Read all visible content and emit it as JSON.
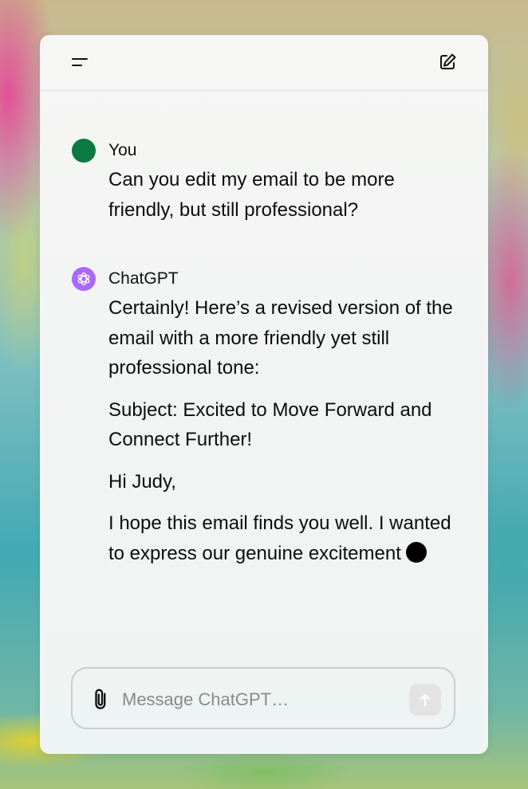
{
  "header": {
    "menu_icon": "menu-icon",
    "compose_icon": "new-chat-icon"
  },
  "messages": [
    {
      "author": "You",
      "avatar_color": "#0b7a40",
      "paragraphs": [
        "Can you edit my email to be more friendly, but still professional?"
      ]
    },
    {
      "author": "ChatGPT",
      "avatar_color": "#ab68ff",
      "avatar_icon": "openai-logo-icon",
      "paragraphs": [
        "Certainly! Here’s a revised version of the email with a more friendly yet still professional tone:",
        "Subject: Excited to Move Forward and Connect Further!",
        "Hi Judy,",
        "I hope this email finds you well. I wanted to express our genuine excitement"
      ]
    }
  ],
  "composer": {
    "placeholder": "Message ChatGPT…",
    "attach_icon": "paperclip-icon",
    "send_icon": "arrow-up-icon"
  }
}
